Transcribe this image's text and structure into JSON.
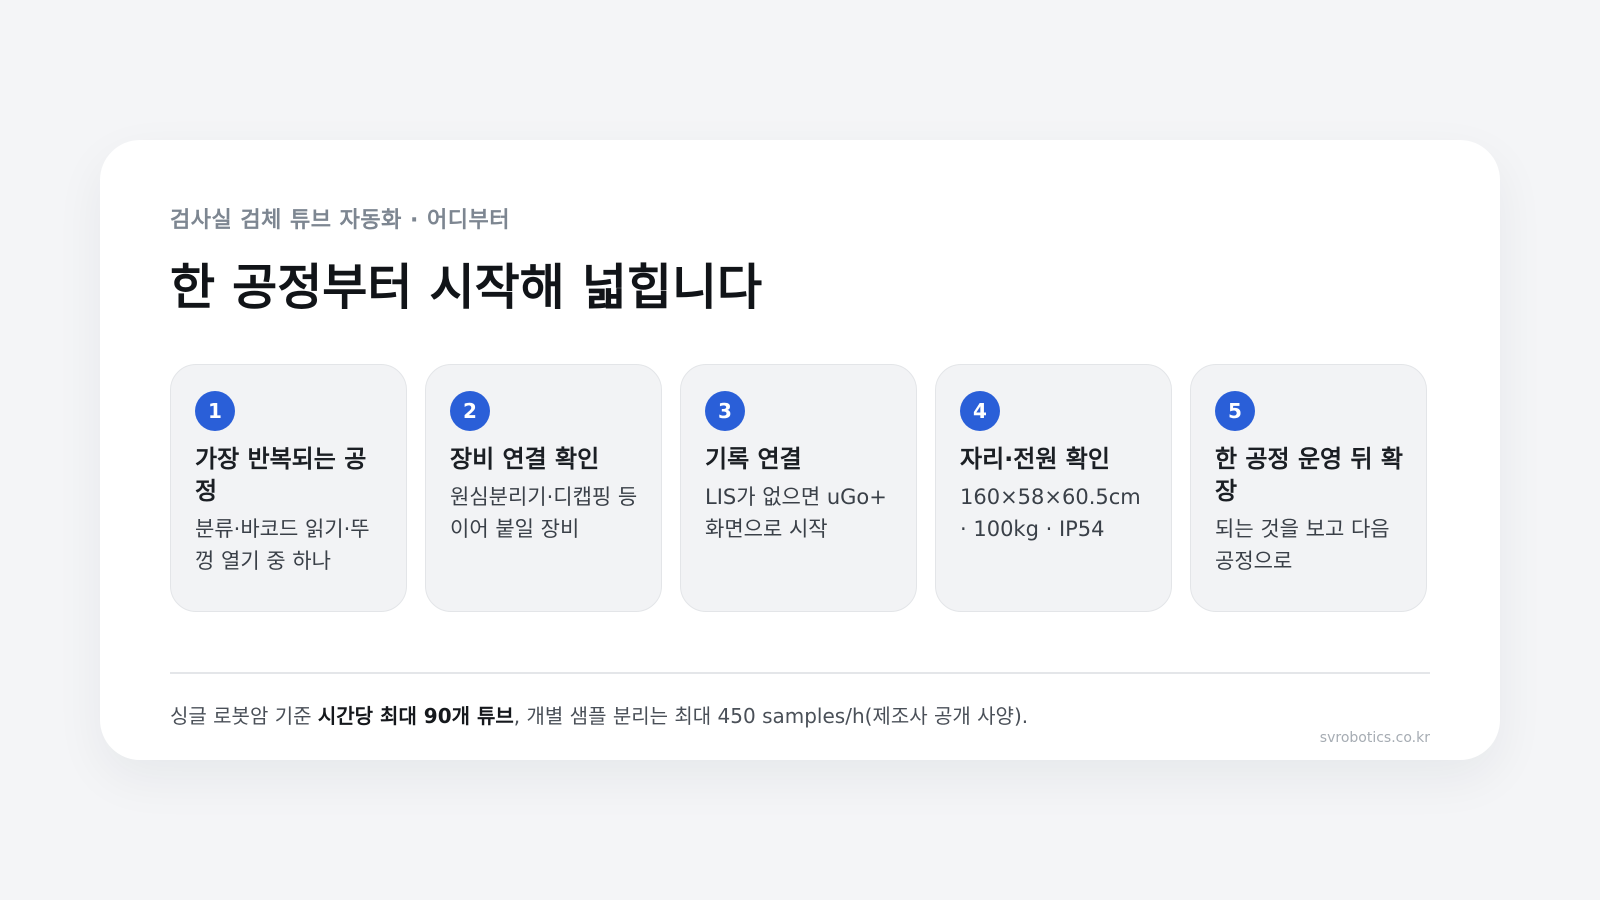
{
  "card": {
    "eyebrow": "검사실 검체 튜브 자동화 · 어디부터",
    "title": "한 공정부터 시작해 넓힙니다"
  },
  "steps": [
    {
      "number": "1",
      "title": "가장 반복되는 공정",
      "description": "분류·바코드 읽기·뚜껑 열기 중 하나"
    },
    {
      "number": "2",
      "title": "장비 연결 확인",
      "description": "원심분리기·디캡핑 등 이어 붙일 장비"
    },
    {
      "number": "3",
      "title": "기록 연결",
      "description": "LIS가 없으면 uGo+ 화면으로 시작"
    },
    {
      "number": "4",
      "title": "자리·전원 확인",
      "description": "160×58×60.5cm · 100kg · IP54"
    },
    {
      "number": "5",
      "title": "한 공정 운영 뒤 확장",
      "description": "되는 것을 보고 다음 공정으로"
    }
  ],
  "footnote": {
    "prefix": "싱글 로봇암 기준 ",
    "highlight": "시간당 최대 90개 튜브",
    "suffix": ", 개별 샘플 분리는 최대 450 samples/h(제조사 공개 사양)."
  },
  "source": "svrobotics.co.kr",
  "colors": {
    "accent": "#2a5fd8",
    "background": "#f4f5f7",
    "card": "#ffffff",
    "step_card": "#f2f3f5"
  }
}
